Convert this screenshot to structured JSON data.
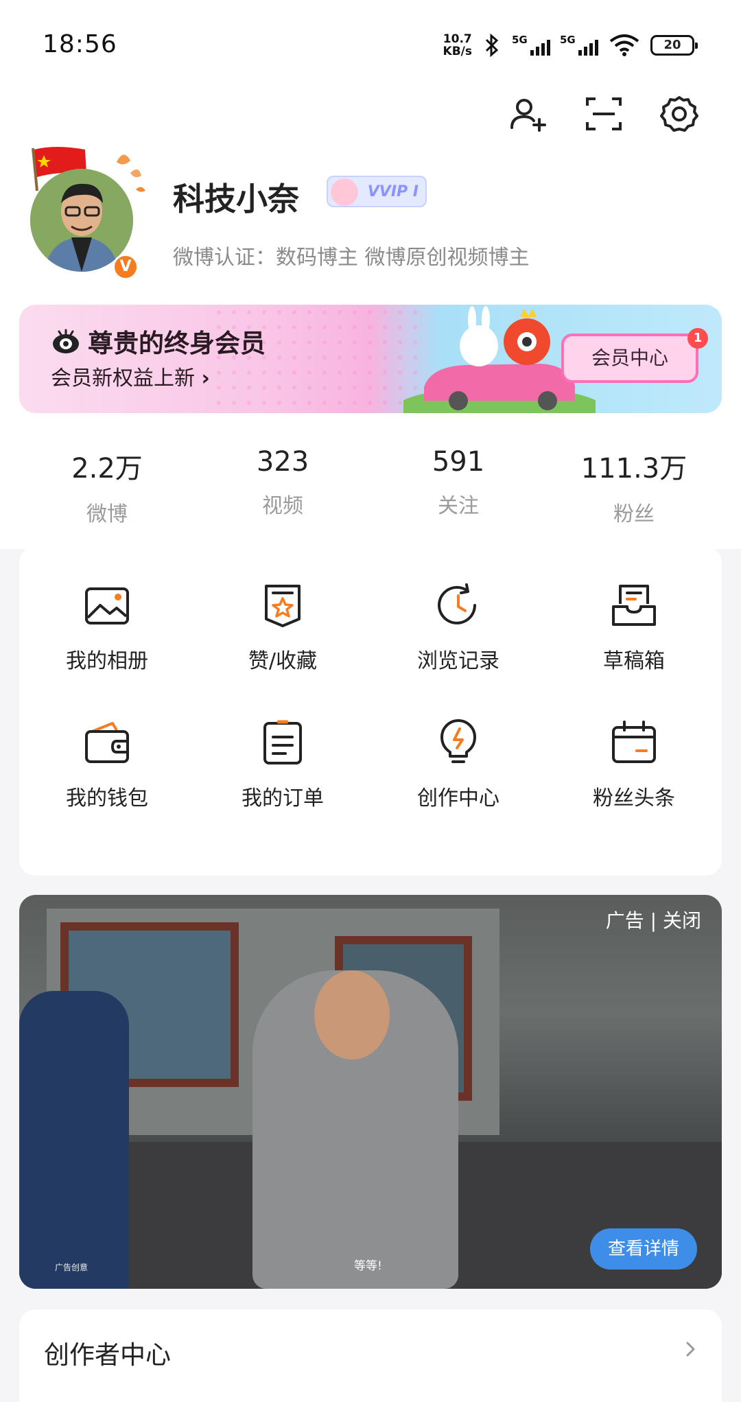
{
  "status_bar": {
    "time": "18:56",
    "speed_top": "10.7",
    "speed_bottom": "KB/s",
    "sim1": "5G",
    "sim2": "5G",
    "battery": "20",
    "icons": [
      "bluetooth-icon",
      "signal-icon",
      "wifi-icon",
      "battery-icon"
    ]
  },
  "header_icons": [
    "add-friend-icon",
    "scan-icon",
    "settings-icon"
  ],
  "profile": {
    "name": "科技小奈",
    "vip_badge": "VVIP I",
    "verification": "微博认证：数码博主 微博原创视频博主",
    "verified_mark": "V"
  },
  "member_banner": {
    "title": "尊贵的终身会员",
    "subtitle": "会员新权益上新",
    "subtitle_arrow": "›",
    "button": "会员中心",
    "badge": "1"
  },
  "stats": [
    {
      "value": "2.2万",
      "label": "微博"
    },
    {
      "value": "323",
      "label": "视频"
    },
    {
      "value": "591",
      "label": "关注"
    },
    {
      "value": "111.3万",
      "label": "粉丝"
    }
  ],
  "grid": [
    {
      "label": "我的相册",
      "icon": "photo-album-icon"
    },
    {
      "label": "赞/收藏",
      "icon": "favorite-icon"
    },
    {
      "label": "浏览记录",
      "icon": "history-icon"
    },
    {
      "label": "草稿箱",
      "icon": "drafts-icon"
    },
    {
      "label": "我的钱包",
      "icon": "wallet-icon"
    },
    {
      "label": "我的订单",
      "icon": "orders-icon"
    },
    {
      "label": "创作中心",
      "icon": "bulb-icon"
    },
    {
      "label": "粉丝头条",
      "icon": "calendar-icon"
    }
  ],
  "ad": {
    "tag": "广告 | 关闭",
    "caption": "等等!",
    "ad_label": "广告创意",
    "button": "查看详情"
  },
  "creator": {
    "title": "创作者中心",
    "chevron": "chevron-right-icon"
  },
  "colors": {
    "accent_orange": "#f57c1f",
    "pink": "#ff6fb5",
    "blue_button": "#3e8ee8",
    "badge_red": "#ff4d4f"
  }
}
